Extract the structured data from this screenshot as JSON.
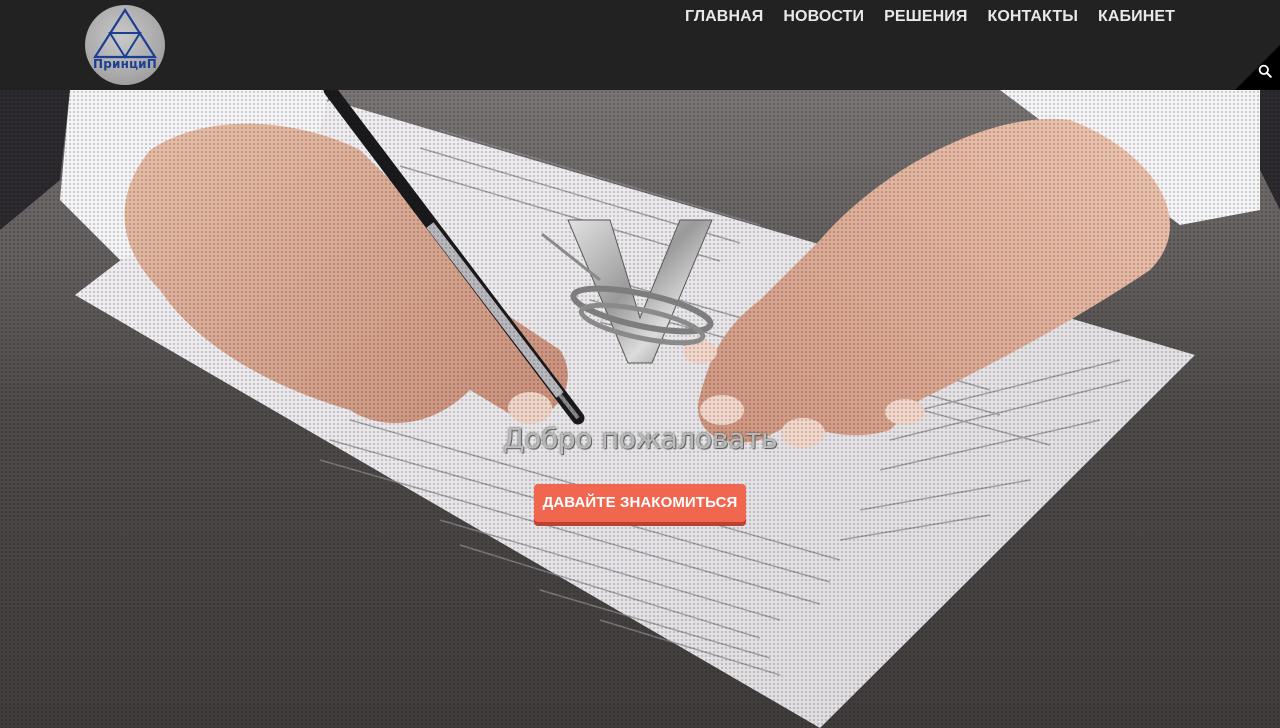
{
  "header": {
    "logo_text": "ПринциП",
    "nav": [
      {
        "label": "ГЛАВНАЯ"
      },
      {
        "label": "НОВОСТИ"
      },
      {
        "label": "РЕШЕНИЯ"
      },
      {
        "label": "КОНТАКТЫ"
      },
      {
        "label": "КАБИНЕТ"
      }
    ],
    "search_icon": "search-icon"
  },
  "hero": {
    "emblem_icon": "v-emblem-icon",
    "welcome_text": "Добро пожаловать",
    "cta_label": "ДАВАЙТЕ ЗНАКОМИТЬСЯ"
  },
  "colors": {
    "header_bg": "#222222",
    "nav_text": "#e8e8e8",
    "cta_bg": "#f0664f",
    "logo_blue": "#1d3f93"
  }
}
